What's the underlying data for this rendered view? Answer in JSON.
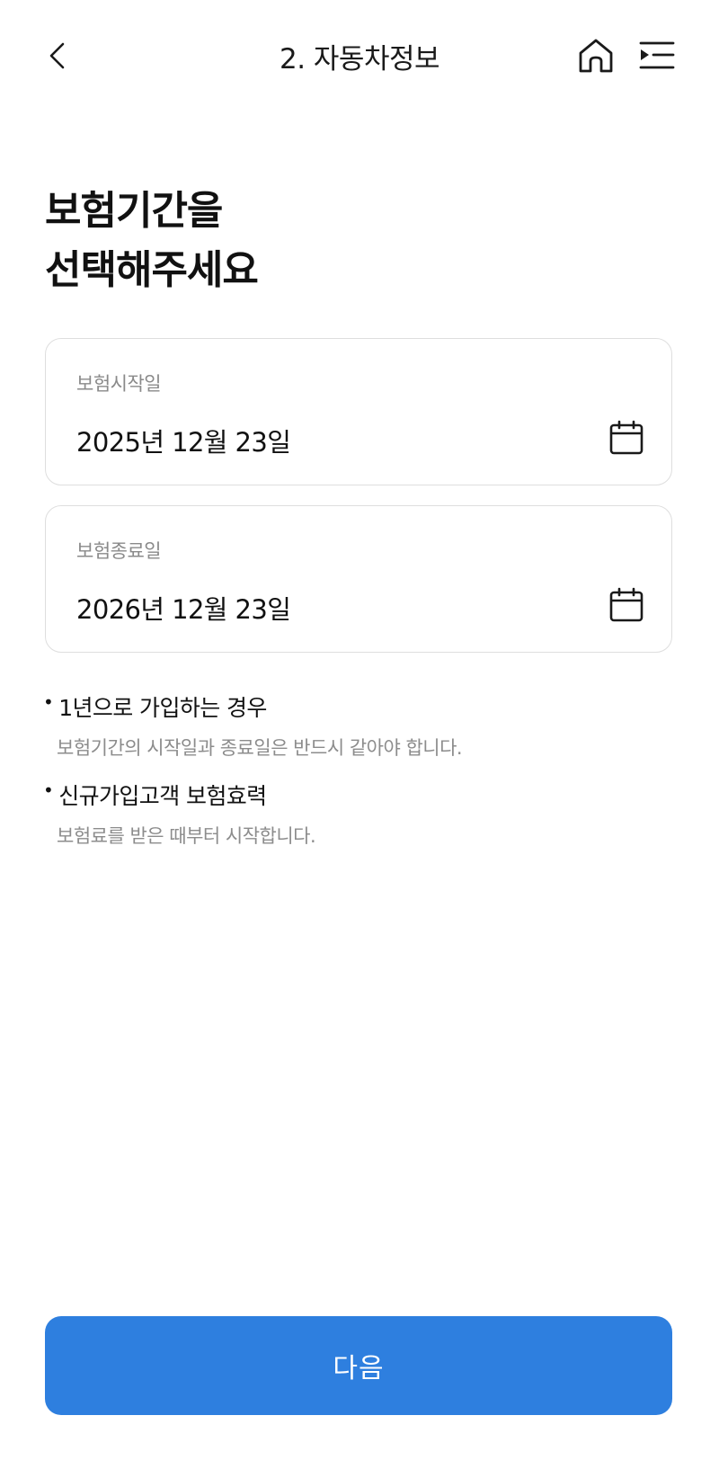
{
  "header": {
    "title": "2. 자동차정보",
    "back_icon": "chevron-left-icon",
    "home_icon": "home-icon",
    "menu_icon": "menu-icon"
  },
  "headline": {
    "line1": "보험기간을",
    "line2": "선택해주세요"
  },
  "start_date": {
    "label": "보험시작일",
    "value": "2025년 12월 23일",
    "icon": "calendar-icon"
  },
  "end_date": {
    "label": "보험종료일",
    "value": "2026년 12월 23일",
    "icon": "calendar-icon"
  },
  "notes": [
    {
      "bullet": "•",
      "title": "1년으로 가입하는 경우",
      "desc": "보험기간의 시작일과 종료일은 반드시 같아야 합니다."
    },
    {
      "bullet": "•",
      "title": "신규가입고객 보험효력",
      "desc": "보험료를 받은 때부터 시작합니다."
    }
  ],
  "footer": {
    "next_label": "다음"
  },
  "colors": {
    "primary": "#2e7fdf",
    "border": "#dedede",
    "muted_text": "#8c8c8c"
  }
}
